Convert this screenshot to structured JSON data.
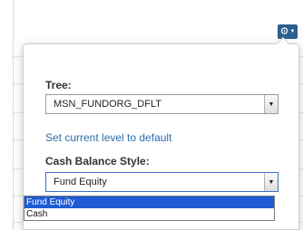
{
  "settings": {
    "gear_icon": "⚙",
    "caret_icon": "▼"
  },
  "tree": {
    "label": "Tree:",
    "value": "MSN_FUNDORG_DFLT"
  },
  "reset_link": "Set current level to default",
  "cash_balance": {
    "label": "Cash Balance Style:",
    "value": "Fund Equity",
    "options": [
      "Fund Equity",
      "Cash"
    ]
  },
  "colors": {
    "accent": "#2c5f8d",
    "link": "#2b6eab",
    "selection": "#1e5bd5"
  }
}
